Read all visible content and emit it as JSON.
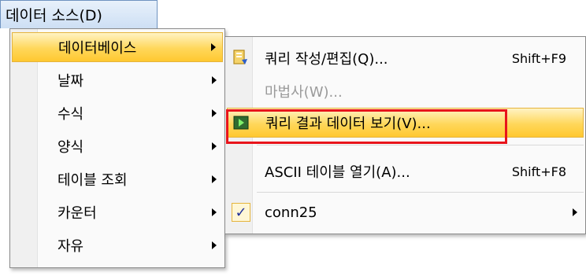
{
  "menubar": {
    "title": "데이터 소스(D)"
  },
  "main_menu": {
    "items": [
      {
        "label": "데이터베이스"
      },
      {
        "label": "날짜"
      },
      {
        "label": "수식"
      },
      {
        "label": "양식"
      },
      {
        "label": "테이블 조회"
      },
      {
        "label": "카운터"
      },
      {
        "label": "자유"
      }
    ]
  },
  "sub_menu": {
    "items": [
      {
        "label": "쿼리 작성/편집(Q)...",
        "shortcut": "Shift+F9"
      },
      {
        "label": "마법사(W)..."
      },
      {
        "label": "쿼리 결과 데이터 보기(V)..."
      },
      {
        "label": "ASCII 테이블 열기(A)...",
        "shortcut": "Shift+F8"
      },
      {
        "label": "conn25"
      }
    ]
  },
  "colors": {
    "highlight": "#ffd75a",
    "annotation_red": "#e8141b",
    "menu_border": "#8a8a8a"
  }
}
